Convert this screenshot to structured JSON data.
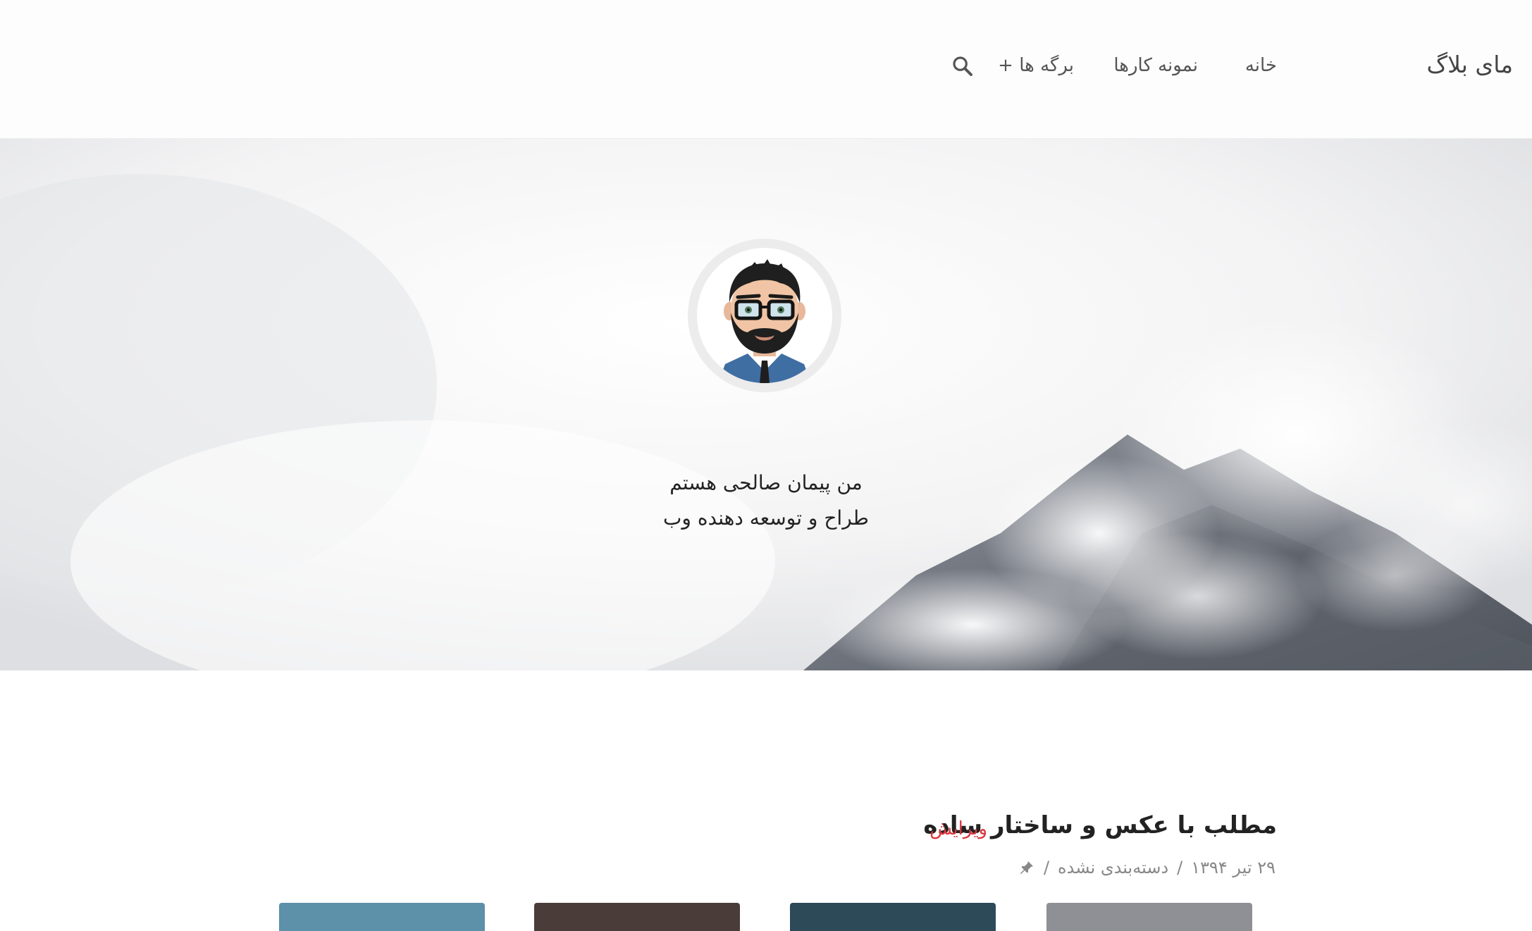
{
  "header": {
    "site_title": "مای بلاگ",
    "nav": {
      "home": "خانه",
      "portfolio": "نمونه کارها",
      "pages": "برگه ها +"
    },
    "search_icon": "search-icon"
  },
  "hero": {
    "avatar_icon": "avatar-illustration",
    "line1": "من پیمان صالحی هستم",
    "line2": "طراح و توسعه دهنده وب"
  },
  "post": {
    "title": "مطلب با عکس و ساختار ساده",
    "edit": "ویرایش",
    "date": "۲۹ تیر ۱۳۹۴",
    "category": "دسته‌بندی نشده",
    "separator": "/",
    "sticky_icon": "pin-icon"
  },
  "colors": {
    "accent": "#d9363e"
  }
}
